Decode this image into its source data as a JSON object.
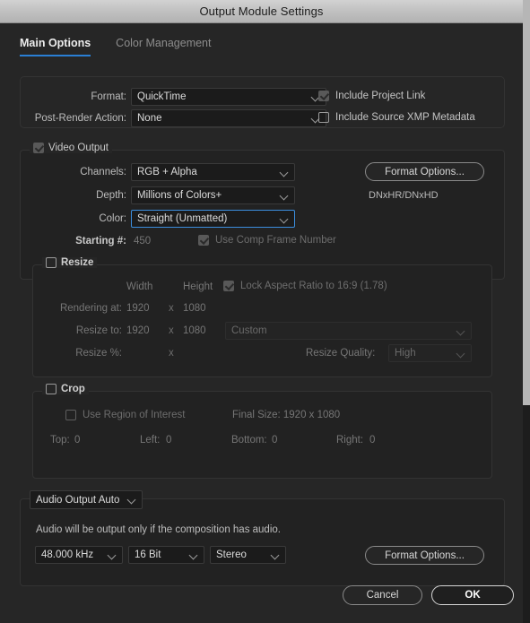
{
  "window": {
    "title": "Output Module Settings"
  },
  "tabs": [
    {
      "label": "Main Options",
      "active": true
    },
    {
      "label": "Color Management",
      "active": false
    }
  ],
  "format_section": {
    "format_label": "Format:",
    "format_value": "QuickTime",
    "post_render_label": "Post-Render Action:",
    "post_render_value": "None",
    "include_project_link": "Include Project Link",
    "include_xmp": "Include Source XMP Metadata"
  },
  "video_output": {
    "group_label": "Video Output",
    "channels_label": "Channels:",
    "channels_value": "RGB + Alpha",
    "depth_label": "Depth:",
    "depth_value": "Millions of Colors+",
    "color_label": "Color:",
    "color_value": "Straight (Unmatted)",
    "starting_label": "Starting #:",
    "starting_value": "450",
    "use_comp_frame_number": "Use Comp Frame Number",
    "format_options_button": "Format Options...",
    "codec_note": "DNxHR/DNxHD"
  },
  "resize": {
    "group_label": "Resize",
    "width_header": "Width",
    "height_header": "Height",
    "lock_aspect": "Lock Aspect Ratio to 16:9 (1.78)",
    "rendering_at_label": "Rendering at:",
    "rendering_width": "1920",
    "rendering_x": "x",
    "rendering_height": "1080",
    "resize_to_label": "Resize to:",
    "resize_width": "1920",
    "resize_x": "x",
    "resize_height": "1080",
    "preset_value": "Custom",
    "resize_pct_label": "Resize %:",
    "resize_pct_x": "x",
    "quality_label": "Resize Quality:",
    "quality_value": "High"
  },
  "crop": {
    "group_label": "Crop",
    "use_roi": "Use Region of Interest",
    "final_size": "Final Size: 1920 x 1080",
    "top_label": "Top:",
    "top_value": "0",
    "left_label": "Left:",
    "left_value": "0",
    "bottom_label": "Bottom:",
    "bottom_value": "0",
    "right_label": "Right:",
    "right_value": "0"
  },
  "audio": {
    "group_label": "Audio Output Auto",
    "note": "Audio will be output only if the composition has audio.",
    "sample_rate": "48.000 kHz",
    "bit_depth": "16 Bit",
    "channels": "Stereo",
    "format_options_button": "Format Options..."
  },
  "footer": {
    "cancel": "Cancel",
    "ok": "OK"
  },
  "colors": {
    "accent": "#2a7fd4",
    "focus_border": "#3b8ede",
    "dialog_bg": "#262626",
    "titlebar": "#c2c2c2"
  }
}
